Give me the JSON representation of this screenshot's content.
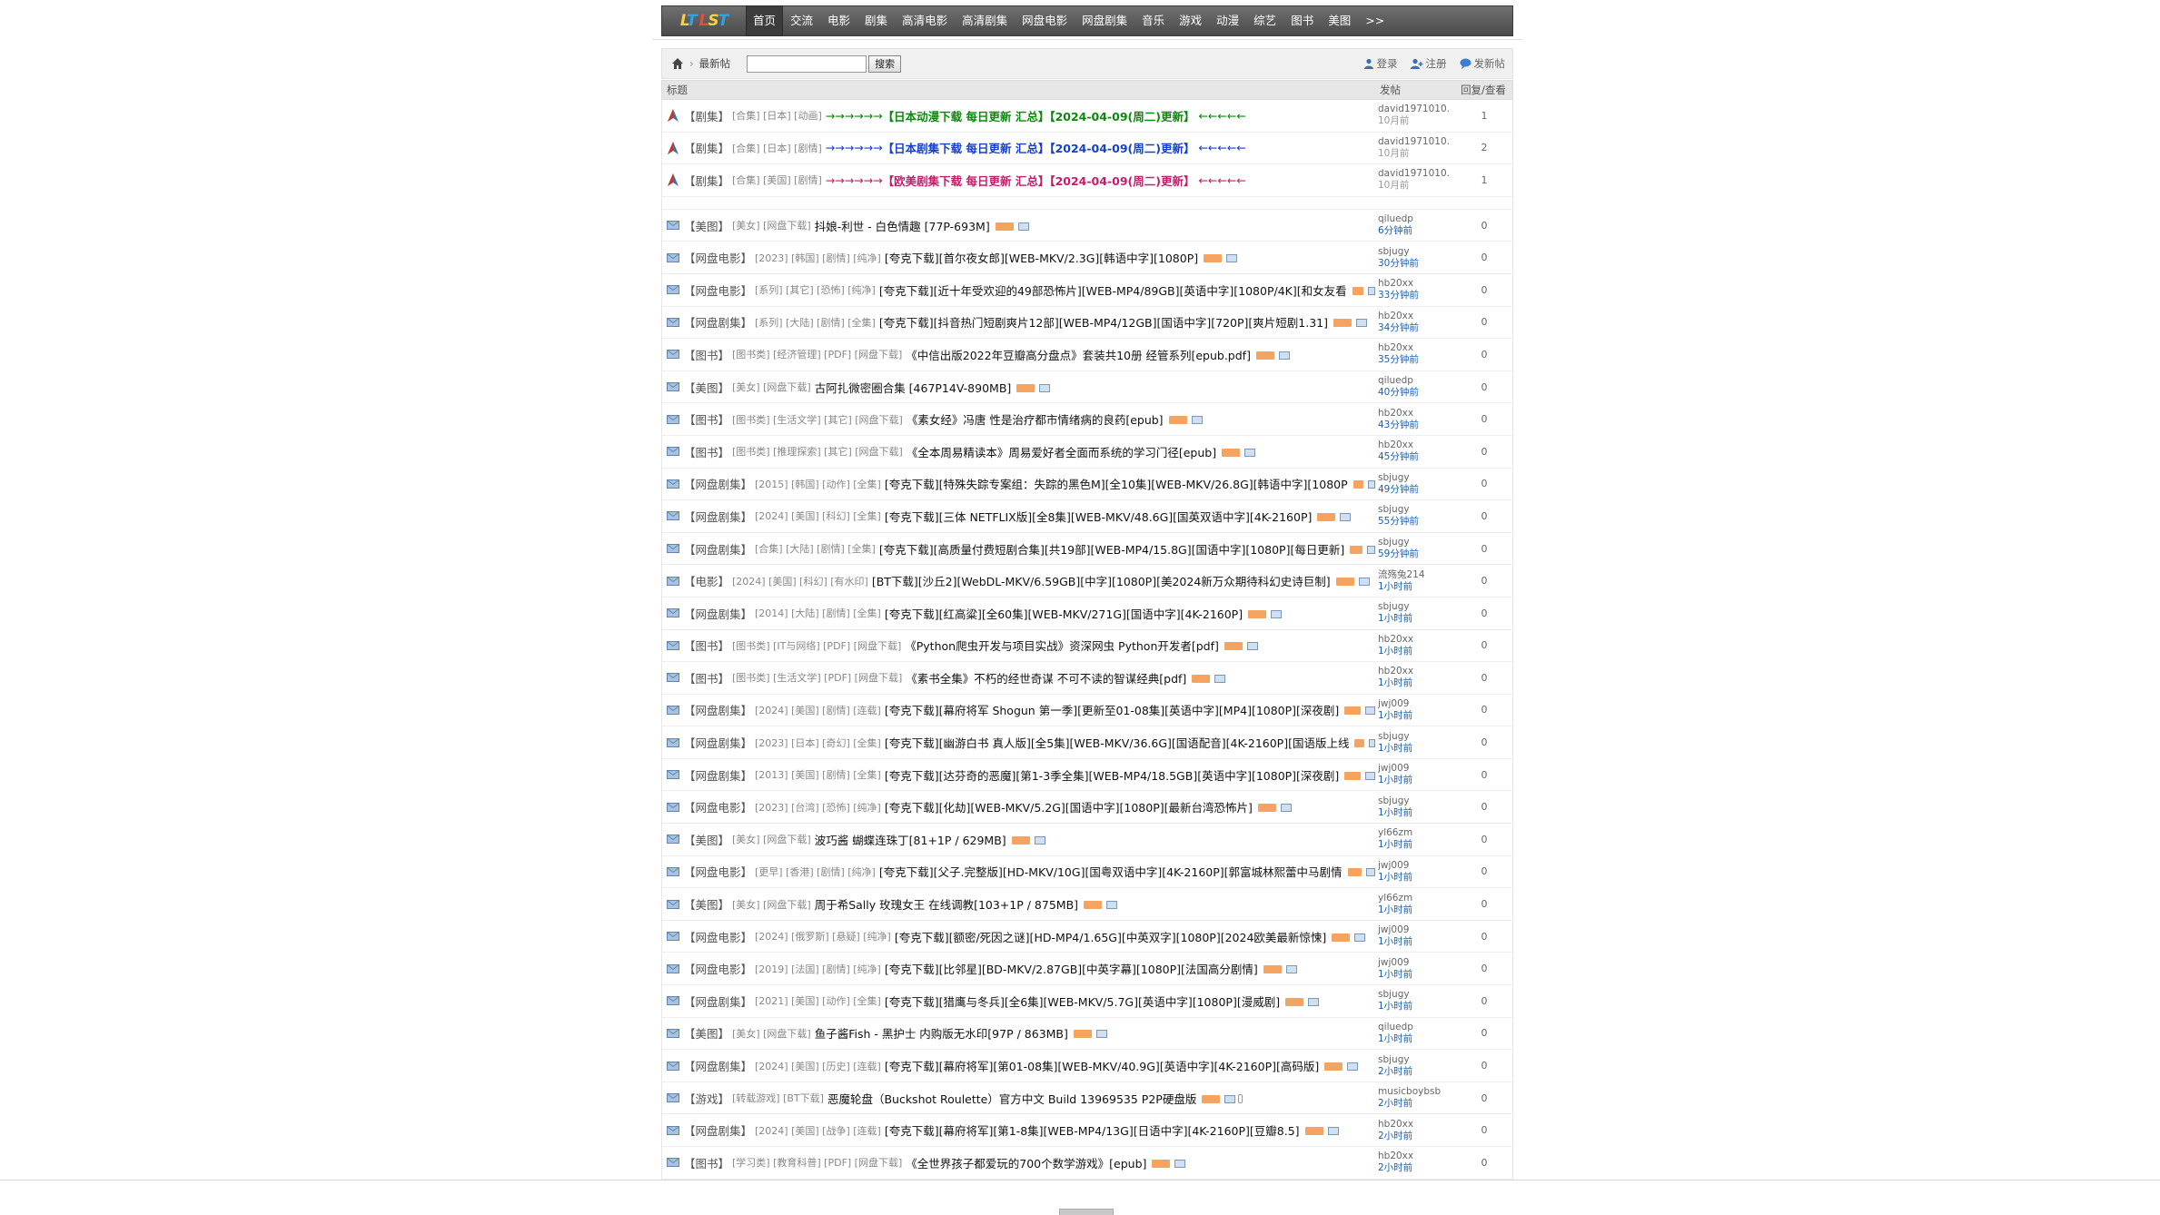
{
  "brand": {
    "logo_text": "LT LST",
    "logo_colors": [
      "#f7d23e",
      "#2ba5e8",
      "#e84c3d"
    ]
  },
  "nav": {
    "items": [
      "首页",
      "交流",
      "电影",
      "剧集",
      "高清电影",
      "高清剧集",
      "网盘电影",
      "网盘剧集",
      "音乐",
      "游戏",
      "动漫",
      "综艺",
      "图书",
      "美图",
      ">>"
    ],
    "active_index": 0
  },
  "toolbar": {
    "breadcrumb": "最新帖",
    "search_placeholder": "",
    "search_button": "搜索",
    "login": "登录",
    "register": "注册",
    "new_post": "发新帖"
  },
  "table": {
    "headers": {
      "title": "标题",
      "poster": "发帖",
      "stats": "回复/查看"
    }
  },
  "sticky": [
    {
      "forum": "【剧集】",
      "tags": "[合集] [日本] [动画]",
      "arrows_l": "→→→→→→",
      "title": "【日本动漫下载 每日更新 汇总】【2024-04-09(周二)更新】",
      "arrows_r": "←←←←←",
      "color": "green",
      "user": "david1971010.",
      "time": "10月前",
      "stats": "1"
    },
    {
      "forum": "【剧集】",
      "tags": "[合集] [日本] [剧情]",
      "arrows_l": "→→→→→→",
      "title": "【日本剧集下载 每日更新 汇总】【2024-04-09(周二)更新】",
      "arrows_r": "←←←←←",
      "color": "blue",
      "user": "david1971010.",
      "time": "10月前",
      "stats": "2"
    },
    {
      "forum": "【剧集】",
      "tags": "[合集] [美国] [剧情]",
      "arrows_l": "→→→→→→",
      "title": "【欧美剧集下载 每日更新 汇总】【2024-04-09(周二)更新】",
      "arrows_r": "←←←←←",
      "color": "pink",
      "user": "david1971010.",
      "time": "10月前",
      "stats": "1"
    }
  ],
  "threads": [
    {
      "forum": "【美图】",
      "tags": "[美女] [网盘下载]",
      "title": "抖娘-利世 - 白色情趣 [77P-693M]",
      "user": "qiluedp",
      "time": "6分钟前",
      "stats": "0",
      "extra": ""
    },
    {
      "forum": "【网盘电影】",
      "tags": "[2023] [韩国] [剧情] [纯净]",
      "title": "[夸克下载][首尔夜女郎][WEB-MKV/2.3G][韩语中字][1080P]",
      "user": "sbjugy",
      "time": "30分钟前",
      "stats": "0",
      "extra": ""
    },
    {
      "forum": "【网盘电影】",
      "tags": "[系列] [其它] [恐怖] [纯净]",
      "title": "[夸克下载][近十年受欢迎的49部恐怖片][WEB-MP4/89GB][英语中字][1080P/4K][和女友看",
      "user": "hb20xx",
      "time": "33分钟前",
      "stats": "0",
      "extra": ""
    },
    {
      "forum": "【网盘剧集】",
      "tags": "[系列] [大陆] [剧情] [全集]",
      "title": "[夸克下载][抖音热门短剧爽片12部][WEB-MP4/12GB][国语中字][720P][爽片短剧1.31]",
      "user": "hb20xx",
      "time": "34分钟前",
      "stats": "0",
      "extra": ""
    },
    {
      "forum": "【图书】",
      "tags": "[图书类] [经济管理] [PDF] [网盘下载]",
      "title": "《中信出版2022年豆瓣高分盘点》套装共10册 经管系列[epub.pdf]",
      "user": "hb20xx",
      "time": "35分钟前",
      "stats": "0",
      "extra": ""
    },
    {
      "forum": "【美图】",
      "tags": "[美女] [网盘下载]",
      "title": "古阿扎微密圈合集 [467P14V-890MB]",
      "user": "qiluedp",
      "time": "40分钟前",
      "stats": "0",
      "extra": ""
    },
    {
      "forum": "【图书】",
      "tags": "[图书类] [生活文学] [其它] [网盘下载]",
      "title": "《素女经》冯唐 性是治疗都市情绪病的良药[epub]",
      "user": "hb20xx",
      "time": "43分钟前",
      "stats": "0",
      "extra": ""
    },
    {
      "forum": "【图书】",
      "tags": "[图书类] [推理探索] [其它] [网盘下载]",
      "title": "《全本周易精读本》周易爱好者全面而系统的学习门径[epub]",
      "user": "hb20xx",
      "time": "45分钟前",
      "stats": "0",
      "extra": ""
    },
    {
      "forum": "【网盘剧集】",
      "tags": "[2015] [韩国] [动作] [全集]",
      "title": "[夸克下载][特殊失踪专案组：失踪的黑色M][全10集][WEB-MKV/26.8G][韩语中字][1080P",
      "user": "sbjugy",
      "time": "49分钟前",
      "stats": "0",
      "extra": ""
    },
    {
      "forum": "【网盘剧集】",
      "tags": "[2024] [美国] [科幻] [全集]",
      "title": "[夸克下载][三体 NETFLIX版][全8集][WEB-MKV/48.6G][国英双语中字][4K-2160P]",
      "user": "sbjugy",
      "time": "55分钟前",
      "stats": "0",
      "extra": ""
    },
    {
      "forum": "【网盘剧集】",
      "tags": "[合集] [大陆] [剧情] [全集]",
      "title": "[夸克下载][高质量付费短剧合集][共19部][WEB-MP4/15.8G][国语中字][1080P][每日更新]",
      "user": "sbjugy",
      "time": "59分钟前",
      "stats": "0",
      "extra": ""
    },
    {
      "forum": "【电影】",
      "tags": "[2024] [美国] [科幻] [有水印]",
      "title": "[BT下载][沙丘2][WebDL-MKV/6.59GB][中字][1080P][美2024新万众期待科幻史诗巨制]",
      "user": "流殇兔214",
      "time": "1小时前",
      "stats": "0",
      "extra": ""
    },
    {
      "forum": "【网盘剧集】",
      "tags": "[2014] [大陆] [剧情] [全集]",
      "title": "[夸克下载][红高粱][全60集][WEB-MKV/271G][国语中字][4K-2160P]",
      "user": "sbjugy",
      "time": "1小时前",
      "stats": "0",
      "extra": ""
    },
    {
      "forum": "【图书】",
      "tags": "[图书类] [IT与网络] [PDF] [网盘下载]",
      "title": "《Python爬虫开发与项目实战》资深网虫 Python开发者[pdf]",
      "user": "hb20xx",
      "time": "1小时前",
      "stats": "0",
      "extra": ""
    },
    {
      "forum": "【图书】",
      "tags": "[图书类] [生活文学] [PDF] [网盘下载]",
      "title": "《素书全集》不朽的经世奇谋 不可不读的智谋经典[pdf]",
      "user": "hb20xx",
      "time": "1小时前",
      "stats": "0",
      "extra": ""
    },
    {
      "forum": "【网盘剧集】",
      "tags": "[2024] [美国] [剧情] [连载]",
      "title": "[夸克下载][幕府将军 Shogun 第一季][更新至01-08集][英语中字][MP4][1080P][深夜剧]",
      "user": "jwj009",
      "time": "1小时前",
      "stats": "0",
      "extra": ""
    },
    {
      "forum": "【网盘剧集】",
      "tags": "[2023] [日本] [奇幻] [全集]",
      "title": "[夸克下载][幽游白书 真人版][全5集][WEB-MKV/36.6G][国语配音][4K-2160P][国语版上线",
      "user": "sbjugy",
      "time": "1小时前",
      "stats": "0",
      "extra": ""
    },
    {
      "forum": "【网盘剧集】",
      "tags": "[2013] [美国] [剧情] [全集]",
      "title": "[夸克下载][达芬奇的恶魔][第1-3季全集][WEB-MP4/18.5GB][英语中字][1080P][深夜剧]",
      "user": "jwj009",
      "time": "1小时前",
      "stats": "0",
      "extra": ""
    },
    {
      "forum": "【网盘电影】",
      "tags": "[2023] [台湾] [恐怖] [纯净]",
      "title": "[夸克下载][化劫][WEB-MKV/5.2G][国语中字][1080P][最新台湾恐怖片]",
      "user": "sbjugy",
      "time": "1小时前",
      "stats": "0",
      "extra": ""
    },
    {
      "forum": "【美图】",
      "tags": "[美女] [网盘下载]",
      "title": "波巧酱 蝴蝶连珠丁[81+1P / 629MB]",
      "user": "yl66zm",
      "time": "1小时前",
      "stats": "0",
      "extra": ""
    },
    {
      "forum": "【网盘电影】",
      "tags": "[更早] [香港] [剧情] [纯净]",
      "title": "[夸克下载][父子.完整版][HD-MKV/10G][国粤双语中字][4K-2160P][郭富城林熙蕾中马剧情",
      "user": "jwj009",
      "time": "1小时前",
      "stats": "0",
      "extra": ""
    },
    {
      "forum": "【美图】",
      "tags": "[美女] [网盘下载]",
      "title": "周于希Sally 玫瑰女王 在线调教[103+1P / 875MB]",
      "user": "yl66zm",
      "time": "1小时前",
      "stats": "0",
      "extra": ""
    },
    {
      "forum": "【网盘电影】",
      "tags": "[2024] [俄罗斯] [悬疑] [纯净]",
      "title": "[夸克下载][额密/死因之谜][HD-MP4/1.65G][中英双字][1080P][2024欧美最新惊悚]",
      "user": "jwj009",
      "time": "1小时前",
      "stats": "0",
      "extra": ""
    },
    {
      "forum": "【网盘电影】",
      "tags": "[2019] [法国] [剧情] [纯净]",
      "title": "[夸克下载][比邻星][BD-MKV/2.87GB][中英字幕][1080P][法国高分剧情]",
      "user": "jwj009",
      "time": "1小时前",
      "stats": "0",
      "extra": ""
    },
    {
      "forum": "【网盘剧集】",
      "tags": "[2021] [美国] [动作] [全集]",
      "title": "[夸克下载][猎鹰与冬兵][全6集][WEB-MKV/5.7G][英语中字][1080P][漫威剧]",
      "user": "sbjugy",
      "time": "1小时前",
      "stats": "0",
      "extra": ""
    },
    {
      "forum": "【美图】",
      "tags": "[美女] [网盘下载]",
      "title": "鱼子酱Fish - 黑护士 内购版无水印[97P / 863MB]",
      "user": "qiluedp",
      "time": "1小时前",
      "stats": "0",
      "extra": ""
    },
    {
      "forum": "【网盘剧集】",
      "tags": "[2024] [美国] [历史] [连载]",
      "title": "[夸克下载][幕府将军][第01-08集][WEB-MKV/40.9G][英语中字][4K-2160P][高码版]",
      "user": "sbjugy",
      "time": "2小时前",
      "stats": "0",
      "extra": ""
    },
    {
      "forum": "【游戏】",
      "tags": "[转载游戏] [BT下载]",
      "title": "恶魔轮盘（Buckshot Roulette）官方中文 Build 13969535 P2P硬盘版",
      "user": "musicboybsb",
      "time": "2小时前",
      "stats": "0",
      "extra": "attach"
    },
    {
      "forum": "【网盘剧集】",
      "tags": "[2024] [美国] [战争] [连载]",
      "title": "[夸克下载][幕府将军][第1-8集][WEB-MP4/13G][日语中字][4K-2160P][豆瓣8.5]",
      "user": "hb20xx",
      "time": "2小时前",
      "stats": "0",
      "extra": ""
    },
    {
      "forum": "【图书】",
      "tags": "[学习类] [教育科普] [PDF] [网盘下载]",
      "title": "《全世界孩子都爱玩的700个数学游戏》[epub]",
      "user": "hb20xx",
      "time": "2小时前",
      "stats": "0",
      "extra": ""
    }
  ]
}
